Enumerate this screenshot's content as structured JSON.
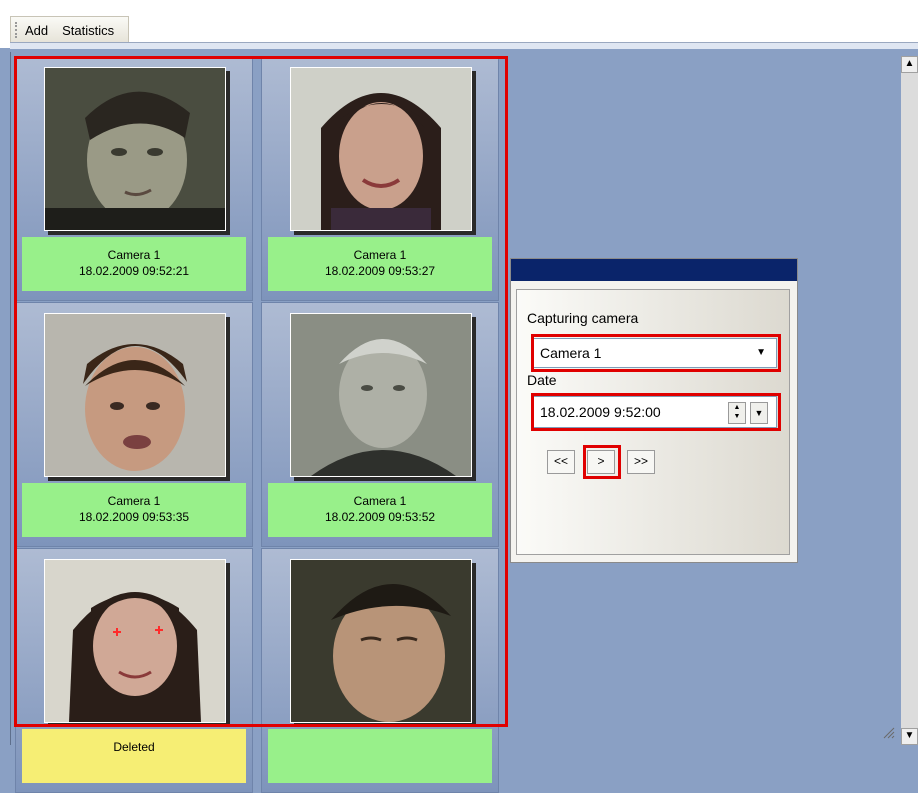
{
  "toolbar": {
    "add_label": "Add",
    "statistics_label": "Statistics"
  },
  "tiles": [
    {
      "camera": "Camera 1",
      "time": "18.02.2009 09:52:21",
      "status": "ok"
    },
    {
      "camera": "Camera 1",
      "time": "18.02.2009 09:53:27",
      "status": "ok"
    },
    {
      "camera": "Camera 1",
      "time": "18.02.2009 09:53:35",
      "status": "ok"
    },
    {
      "camera": "Camera 1",
      "time": "18.02.2009 09:53:52",
      "status": "ok"
    },
    {
      "label": "Deleted",
      "status": "deleted"
    },
    {
      "label": "",
      "status": "ok"
    }
  ],
  "filter": {
    "camera_label": "Capturing camera",
    "camera_value": "Camera 1",
    "date_label": "Date",
    "date_value": "18.02.2009  9:52:00",
    "first_label": "<<",
    "next_label": ">",
    "last_label": ">>"
  },
  "colors": {
    "caption_ok": "#98f08a",
    "caption_deleted": "#f6ee74",
    "highlight": "#e00000",
    "panel_title": "#0a246a"
  }
}
